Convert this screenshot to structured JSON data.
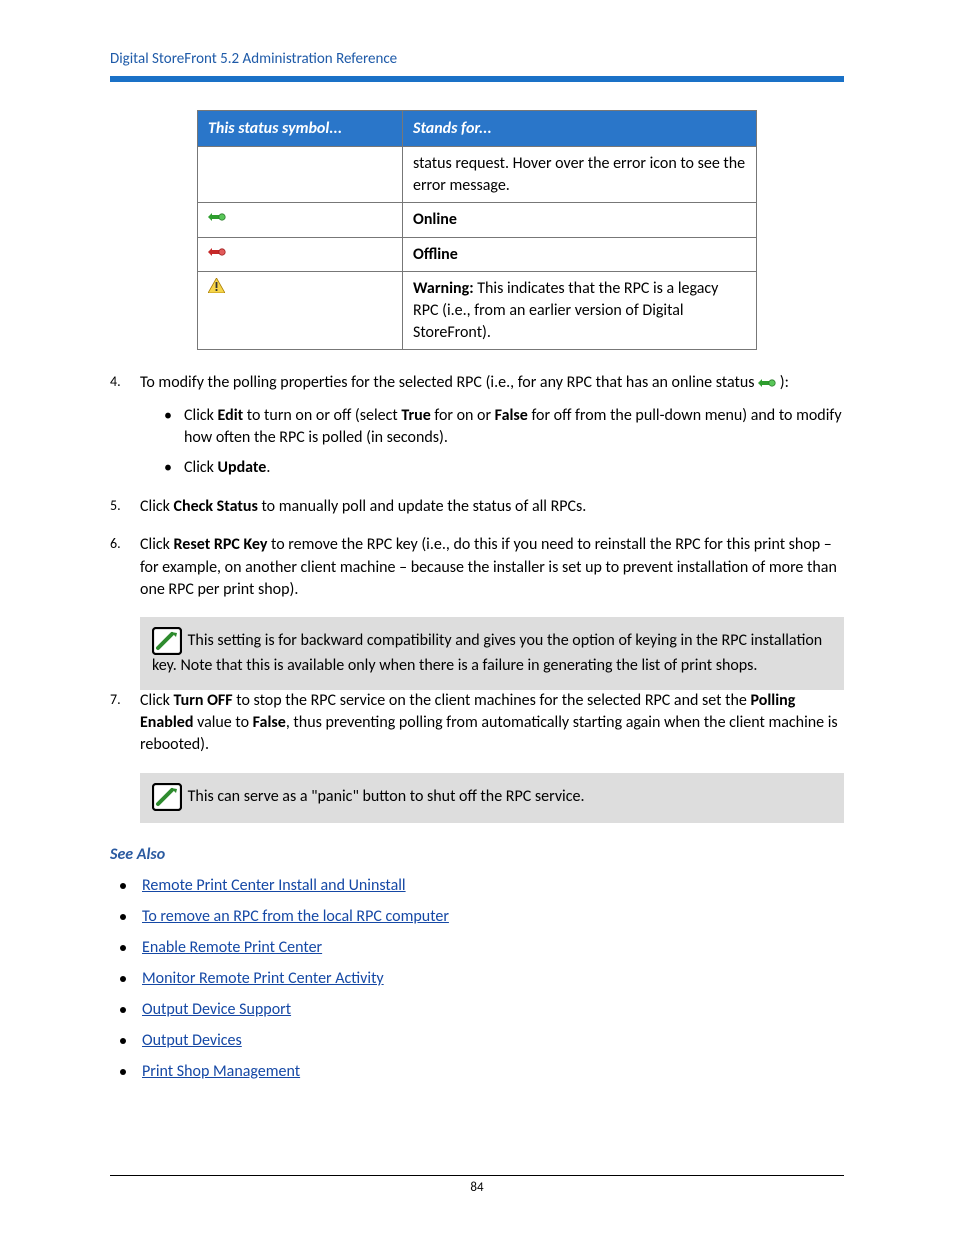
{
  "header": {
    "title": "Digital StoreFront 5.2 Administration Reference"
  },
  "table": {
    "headers": {
      "col1": "This status symbol...",
      "col2": "Stands for..."
    },
    "rows": {
      "error": "status request. Hover over the error icon to see the error message.",
      "online": "Online",
      "offline": "Offline",
      "warning_label": "Warning:",
      "warning_text": " This indicates that the RPC is a legacy RPC (i.e., from an earlier version of Digital StoreFront)."
    }
  },
  "steps": {
    "s4": {
      "pre": "To modify the polling properties for the selected RPC (i.e., for any RPC that has an online status ",
      "post": "):",
      "b1_pre": "Click ",
      "b1_edit": "Edit",
      "b1_mid": " to turn on or off (select ",
      "b1_true": "True",
      "b1_mid2": " for on or ",
      "b1_false": "False",
      "b1_end": " for off from the pull-down menu) and to modify how often the RPC is polled (in seconds).",
      "b2_pre": "Click ",
      "b2_update": "Update",
      "b2_end": "."
    },
    "s5": {
      "pre": "Click ",
      "bold": "Check Status",
      "post": " to manually poll and update the status of all RPCs."
    },
    "s6": {
      "pre": "Click ",
      "bold": "Reset RPC Key",
      "post": " to remove the RPC key (i.e., do this if you need to reinstall the RPC for this print shop – for example, on another client machine – because the installer is set up to prevent installation of more than one RPC per print shop)."
    },
    "note1": "This setting is for backward compatibility and gives you the option of keying in the RPC installation key. Note that this is available only when there is a failure in generating the list of print shops.",
    "s7": {
      "pre": "Click ",
      "b1": "Turn OFF",
      "mid1": " to stop the RPC service on the client machines for the selected RPC and set the ",
      "b2": "Polling Enabled",
      "mid2": " value to ",
      "b3": "False",
      "end": ", thus preventing polling from automatically starting again when the client machine is rebooted)."
    },
    "note2": "This can serve as a \"panic\" button to shut off the RPC service."
  },
  "see_also": {
    "heading": "See Also",
    "links": [
      "Remote Print Center Install and Uninstall",
      "To remove an RPC from the local RPC computer",
      "Enable Remote Print Center",
      "Monitor Remote Print Center Activity",
      "Output Device Support",
      "Output Devices",
      "Print Shop Management"
    ]
  },
  "footer": {
    "page": "84"
  }
}
